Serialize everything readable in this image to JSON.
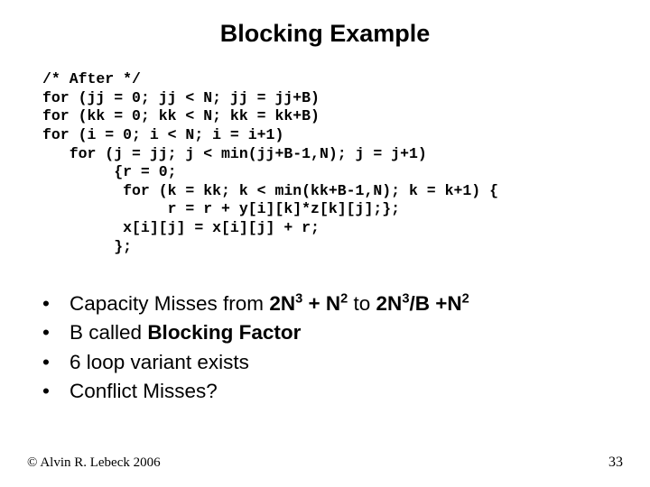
{
  "title": "Blocking Example",
  "code": {
    "l1": "/* After */",
    "l2": "for (jj = 0; jj < N; jj = jj+B)",
    "l3": "for (kk = 0; kk < N; kk = kk+B)",
    "l4": "for (i = 0; i < N; i = i+1)",
    "l5": "   for (j = jj; j < min(jj+B-1,N); j = j+1)",
    "l6": "        {r = 0;",
    "l7": "         for (k = kk; k < min(kk+B-1,N); k = k+1) {",
    "l8": "              r = r + y[i][k]*z[k][j];};",
    "l9": "         x[i][j] = x[i][j] + r;",
    "l10": "        };"
  },
  "bullets": {
    "b1_part1": "Capacity Misses from ",
    "b1_2n3": "2N",
    "b1_exp3a": "3",
    "b1_plus1": " + N",
    "b1_exp2a": "2",
    "b1_to": "  to  ",
    "b1_2n3b": "2N",
    "b1_exp3b": "3",
    "b1_overB": "/B ",
    "b1_plusN": "+N",
    "b1_exp2b": "2",
    "b2_part1": "B called ",
    "b2_bf": "Blocking Factor",
    "b3": "6 loop variant exists",
    "b4": "Conflict Misses?"
  },
  "footer": {
    "left": "© Alvin R. Lebeck 2006",
    "right": "33"
  }
}
